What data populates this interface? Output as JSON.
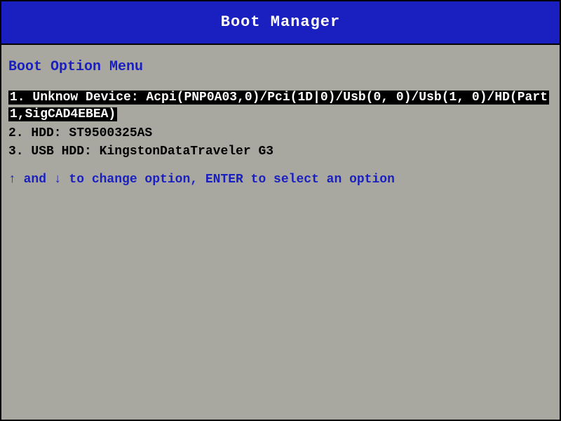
{
  "header": {
    "title": "Boot Manager"
  },
  "menu": {
    "title": "Boot Option Menu",
    "options": [
      {
        "label": "1. Unknow Device: Acpi(PNP0A03,0)/Pci(1D|0)/Usb(0, 0)/Usb(1, 0)/HD(Part1,SigCAD4EBEA)",
        "selected": true
      },
      {
        "label": "2. HDD: ST9500325AS",
        "selected": false
      },
      {
        "label": "3. USB HDD: KingstonDataTraveler G3",
        "selected": false
      }
    ],
    "hint": "↑ and ↓ to change option, ENTER to select an option"
  }
}
